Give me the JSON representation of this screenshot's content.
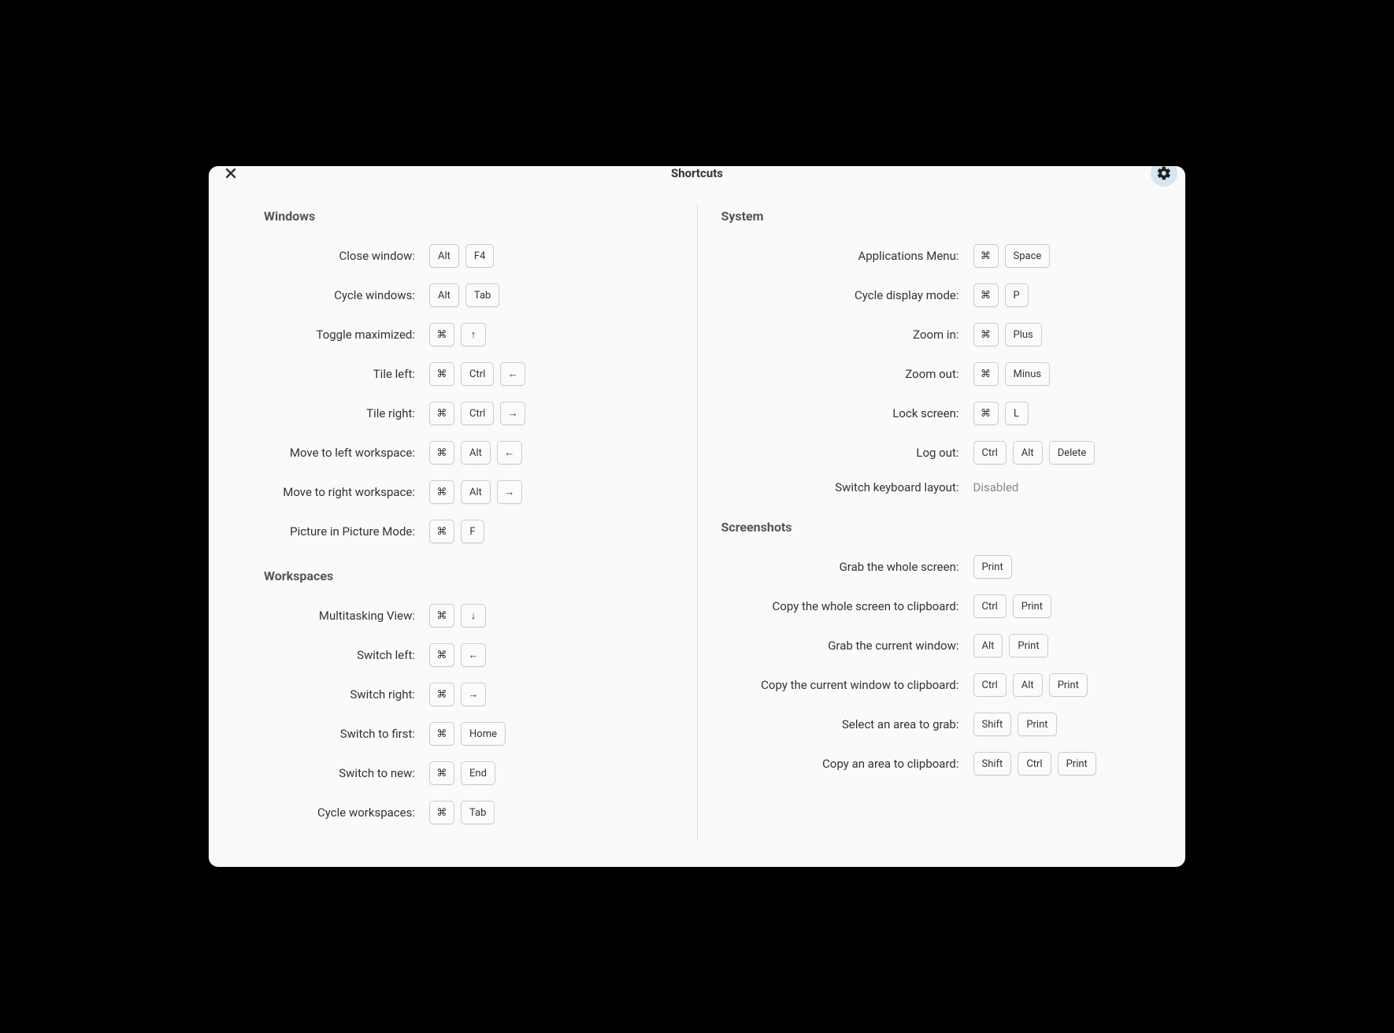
{
  "title": "Shortcuts",
  "glyphs": {
    "cmd": "⌘",
    "up": "↑",
    "down": "↓",
    "left": "←",
    "right": "→"
  },
  "left_sections": [
    {
      "title": "Windows",
      "rows": [
        {
          "label": "Close window:",
          "keys": [
            "Alt",
            "F4"
          ]
        },
        {
          "label": "Cycle windows:",
          "keys": [
            "Alt",
            "Tab"
          ]
        },
        {
          "label": "Toggle maximized:",
          "keys": [
            "cmd",
            "up"
          ]
        },
        {
          "label": "Tile left:",
          "keys": [
            "cmd",
            "Ctrl",
            "left"
          ]
        },
        {
          "label": "Tile right:",
          "keys": [
            "cmd",
            "Ctrl",
            "right"
          ]
        },
        {
          "label": "Move to left workspace:",
          "keys": [
            "cmd",
            "Alt",
            "left"
          ]
        },
        {
          "label": "Move to right workspace:",
          "keys": [
            "cmd",
            "Alt",
            "right"
          ]
        },
        {
          "label": "Picture in Picture Mode:",
          "keys": [
            "cmd",
            "F"
          ]
        }
      ]
    },
    {
      "title": "Workspaces",
      "rows": [
        {
          "label": "Multitasking View:",
          "keys": [
            "cmd",
            "down"
          ]
        },
        {
          "label": "Switch left:",
          "keys": [
            "cmd",
            "left"
          ]
        },
        {
          "label": "Switch right:",
          "keys": [
            "cmd",
            "right"
          ]
        },
        {
          "label": "Switch to first:",
          "keys": [
            "cmd",
            "Home"
          ]
        },
        {
          "label": "Switch to new:",
          "keys": [
            "cmd",
            "End"
          ]
        },
        {
          "label": "Cycle workspaces:",
          "keys": [
            "cmd",
            "Tab"
          ]
        }
      ]
    }
  ],
  "right_sections": [
    {
      "title": "System",
      "rows": [
        {
          "label": "Applications Menu:",
          "keys": [
            "cmd",
            "Space"
          ]
        },
        {
          "label": "Cycle display mode:",
          "keys": [
            "cmd",
            "P"
          ]
        },
        {
          "label": "Zoom in:",
          "keys": [
            "cmd",
            "Plus"
          ]
        },
        {
          "label": "Zoom out:",
          "keys": [
            "cmd",
            "Minus"
          ]
        },
        {
          "label": "Lock screen:",
          "keys": [
            "cmd",
            "L"
          ]
        },
        {
          "label": "Log out:",
          "keys": [
            "Ctrl",
            "Alt",
            "Delete"
          ]
        },
        {
          "label": "Switch keyboard layout:",
          "disabled": "Disabled"
        }
      ]
    },
    {
      "title": "Screenshots",
      "rows": [
        {
          "label": "Grab the whole screen:",
          "keys": [
            "Print"
          ]
        },
        {
          "label": "Copy the whole screen to clipboard:",
          "keys": [
            "Ctrl",
            "Print"
          ]
        },
        {
          "label": "Grab the current window:",
          "keys": [
            "Alt",
            "Print"
          ]
        },
        {
          "label": "Copy the current window to clipboard:",
          "keys": [
            "Ctrl",
            "Alt",
            "Print"
          ]
        },
        {
          "label": "Select an area to grab:",
          "keys": [
            "Shift",
            "Print"
          ]
        },
        {
          "label": "Copy an area to clipboard:",
          "keys": [
            "Shift",
            "Ctrl",
            "Print"
          ]
        }
      ]
    }
  ]
}
